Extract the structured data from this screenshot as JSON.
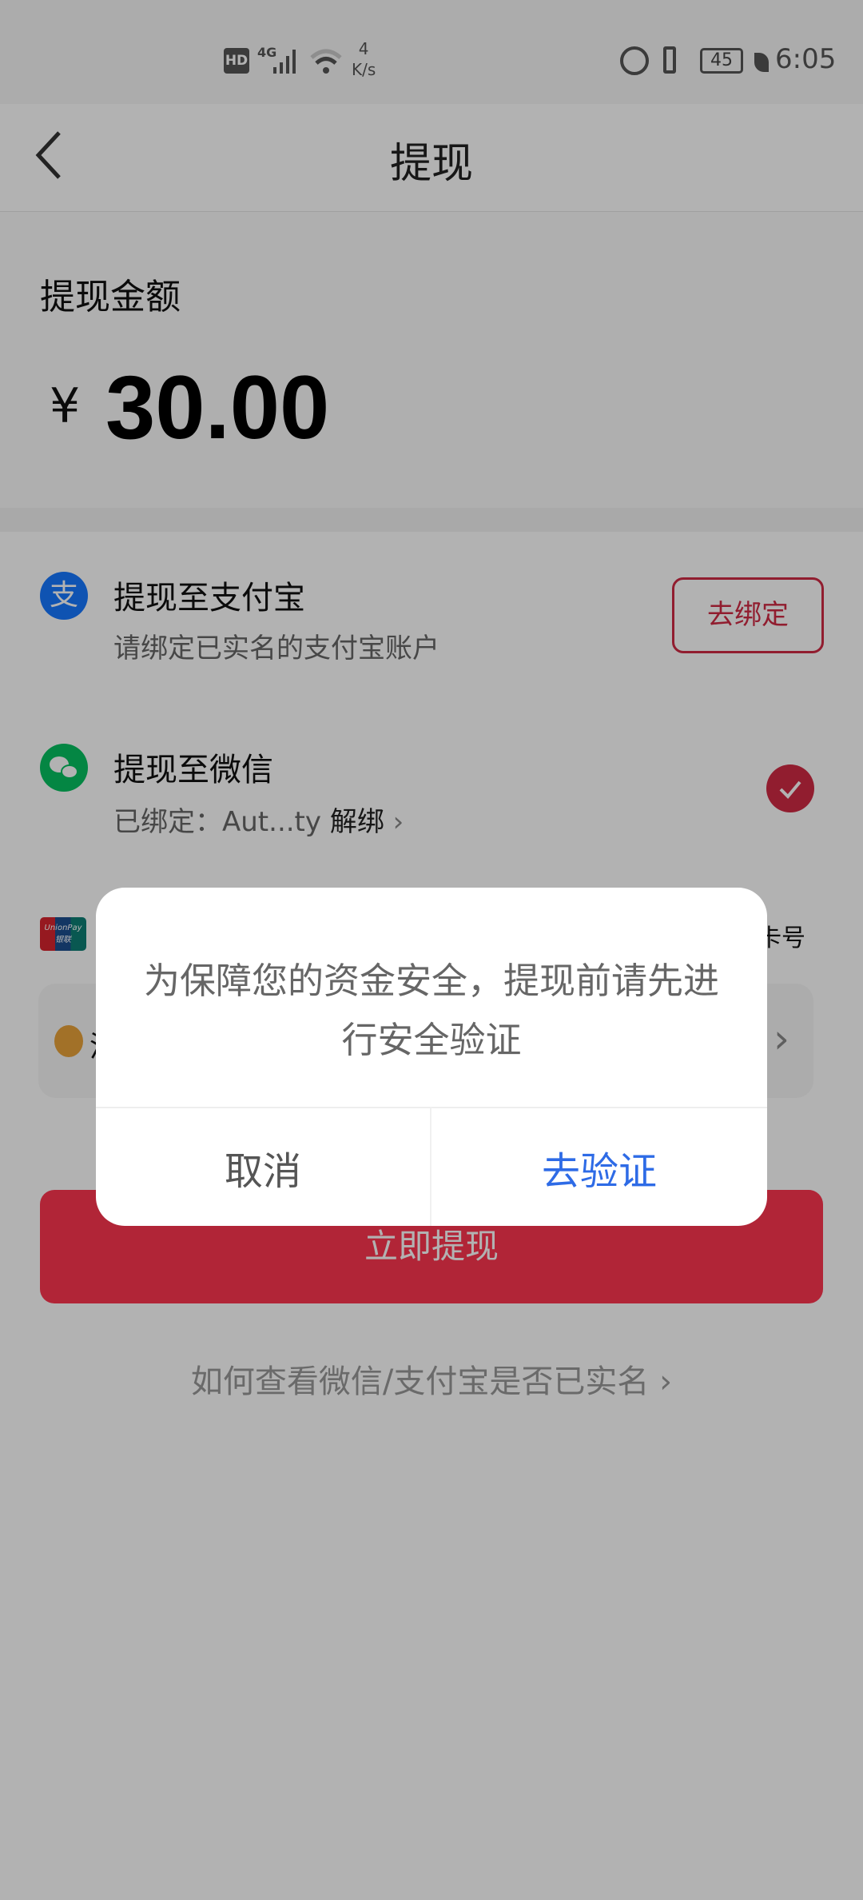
{
  "status_bar": {
    "network": "4G",
    "speed_value": "4",
    "speed_unit": "K/s",
    "battery": "45",
    "time": "6:05",
    "hd": "HD"
  },
  "header": {
    "title": "提现"
  },
  "amount": {
    "label": "提现金额",
    "currency": "¥",
    "value": "30.00"
  },
  "methods": [
    {
      "title": "提现至支付宝",
      "subtitle": "请绑定已实名的支付宝账户",
      "button": "去绑定",
      "icon": "alipay-icon"
    },
    {
      "title": "提现至微信",
      "subtitle_prefix": "已绑定：Aut...ty",
      "unbind": "解绑",
      "selected": true,
      "icon": "wechat-icon"
    },
    {
      "title_fragment": "卡号",
      "icon": "unionpay-icon",
      "card_fragment": "浦",
      "unionpay_logo": "UnionPay 银联"
    }
  ],
  "submit_button": "立即提现",
  "help_link": "如何查看微信/支付宝是否已实名",
  "dialog": {
    "message": "为保障您的资金安全，提现前请先进行安全验证",
    "cancel": "取消",
    "confirm": "去验证"
  },
  "colors": {
    "accent": "#d02a44",
    "confirm_blue": "#2e6be6",
    "alipay": "#1677ff",
    "wechat": "#07c160"
  }
}
